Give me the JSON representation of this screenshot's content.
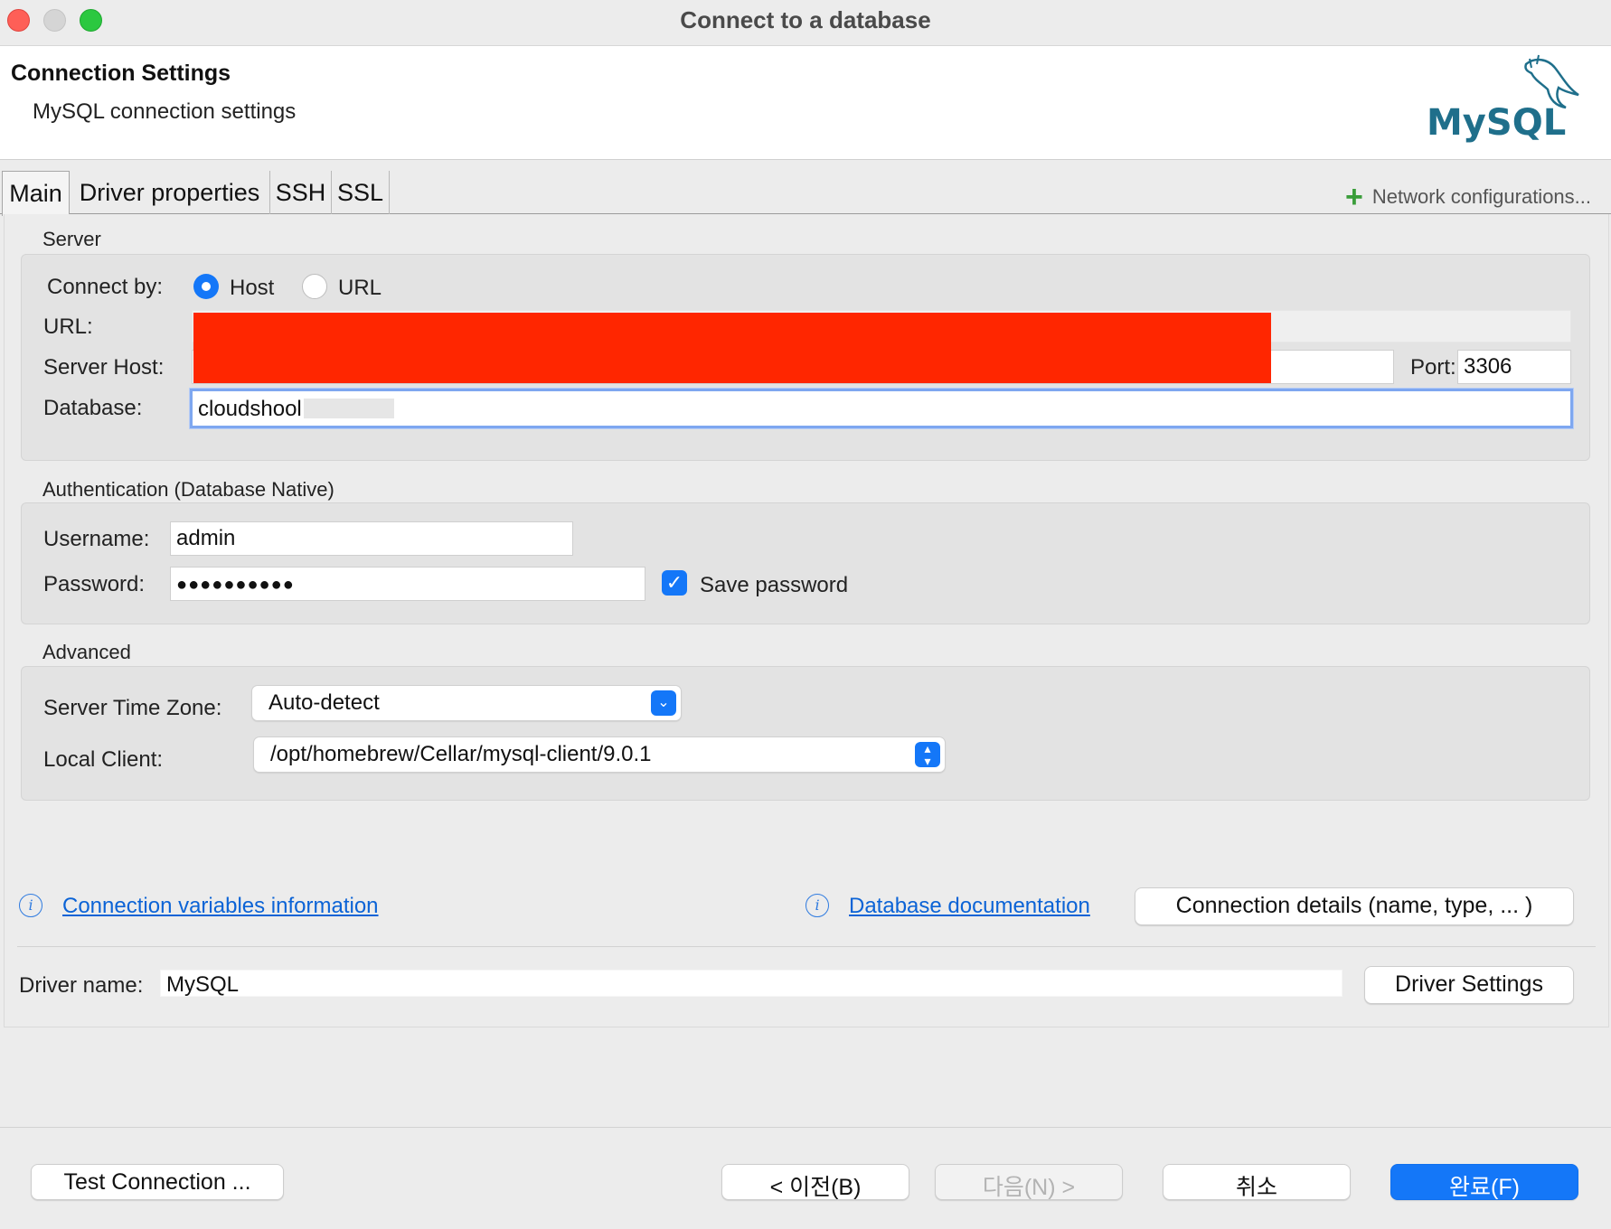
{
  "window": {
    "title": "Connect to a database"
  },
  "header": {
    "title": "Connection Settings",
    "subtitle": "MySQL connection settings",
    "logo_text": "MySQL"
  },
  "tabs": [
    {
      "label": "Main",
      "selected": true
    },
    {
      "label": "Driver properties"
    },
    {
      "label": "SSH"
    },
    {
      "label": "SSL"
    }
  ],
  "network_config": {
    "label": "Network configurations..."
  },
  "server": {
    "section_label": "Server",
    "connect_by_label": "Connect by:",
    "options": [
      "Host",
      "URL"
    ],
    "selected_option": "Host",
    "url_label": "URL:",
    "url_value": "",
    "host_label": "Server Host:",
    "host_value": "",
    "port_label": "Port:",
    "port_value": "3306",
    "database_label": "Database:",
    "database_value": "cloudshool"
  },
  "auth": {
    "section_label": "Authentication (Database Native)",
    "username_label": "Username:",
    "username_value": "admin",
    "password_label": "Password:",
    "password_value": "●●●●●●●●●●",
    "save_password_label": "Save password",
    "save_password_checked": true
  },
  "advanced": {
    "section_label": "Advanced",
    "timezone_label": "Server Time Zone:",
    "timezone_value": "Auto-detect",
    "local_client_label": "Local Client:",
    "local_client_value": "/opt/homebrew/Cellar/mysql-client/9.0.1"
  },
  "links": {
    "conn_vars": "Connection variables information",
    "db_docs": "Database documentation"
  },
  "conn_details_button": "Connection details (name, type, ... )",
  "driver": {
    "label": "Driver name:",
    "value": "MySQL",
    "settings_button": "Driver Settings"
  },
  "footer": {
    "test_button": "Test Connection ...",
    "back_button": "< 이전(B)",
    "next_button": "다음(N) >",
    "cancel_button": "취소",
    "finish_button": "완료(F)"
  },
  "colors": {
    "accent": "#1477f8",
    "link": "#0b63d6",
    "redaction": "#ff2600",
    "mysql_teal": "#1f6f8b",
    "mysql_orange": "#e48e00"
  }
}
